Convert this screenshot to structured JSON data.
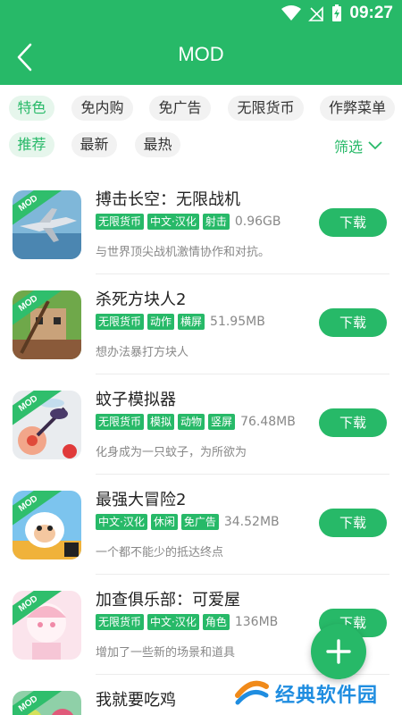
{
  "status": {
    "time": "09:27"
  },
  "header": {
    "title": "MOD"
  },
  "categories": [
    {
      "label": "特色",
      "active": true
    },
    {
      "label": "免内购",
      "active": false
    },
    {
      "label": "免广告",
      "active": false
    },
    {
      "label": "无限货币",
      "active": false
    },
    {
      "label": "作弊菜单",
      "active": false
    }
  ],
  "sort": [
    {
      "label": "推荐",
      "active": true
    },
    {
      "label": "最新",
      "active": false
    },
    {
      "label": "最热",
      "active": false
    }
  ],
  "filter_label": "筛选",
  "download_label": "下载",
  "badge_text": "MOD",
  "apps": [
    {
      "title": "搏击长空：无限战机",
      "tags": [
        "无限货币",
        "中文·汉化",
        "射击"
      ],
      "size": "0.96GB",
      "desc": "与世界顶尖战机激情协作和对抗。",
      "icon": "fighter-jet-game-icon"
    },
    {
      "title": "杀死方块人2",
      "tags": [
        "无限货币",
        "动作",
        "横屏"
      ],
      "size": "51.95MB",
      "desc": "想办法暴打方块人",
      "icon": "block-man-game-icon"
    },
    {
      "title": "蚊子模拟器",
      "tags": [
        "无限货币",
        "模拟",
        "动物",
        "竖屏"
      ],
      "size": "76.48MB",
      "desc": "化身成为一只蚊子，为所欲为",
      "icon": "mosquito-game-icon"
    },
    {
      "title": "最强大冒险2",
      "tags": [
        "中文·汉化",
        "休闲",
        "免广告"
      ],
      "size": "34.52MB",
      "desc": "一个都不能少的抵达终点",
      "icon": "sheep-adventure-game-icon"
    },
    {
      "title": "加查俱乐部：可爱屋",
      "tags": [
        "无限货币",
        "中文·汉化",
        "角色"
      ],
      "size": "136MB",
      "desc": "增加了一些新的场景和道具",
      "icon": "gacha-club-game-icon"
    },
    {
      "title": "我就要吃鸡",
      "tags": [],
      "size": "",
      "desc": "",
      "icon": "chicken-game-icon"
    }
  ],
  "watermark": {
    "text": "经典软件园"
  },
  "colors": {
    "primary": "#27b968",
    "watermark": "#1f8de0"
  }
}
